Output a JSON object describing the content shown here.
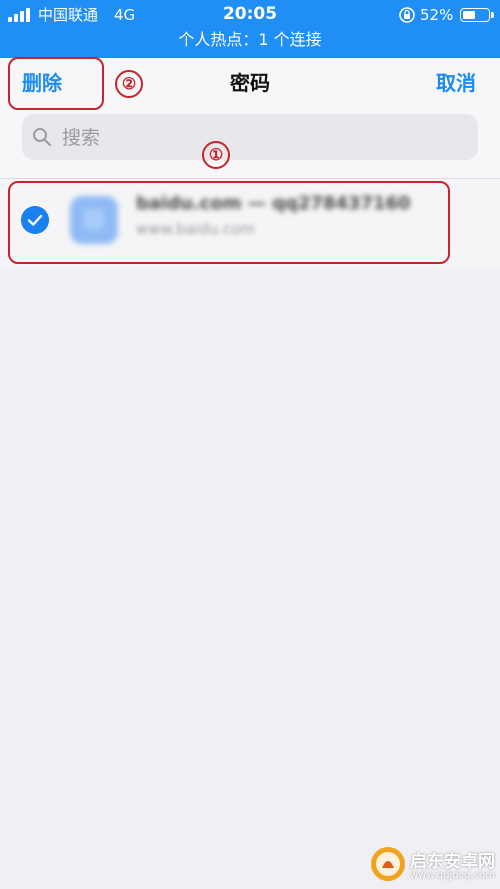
{
  "status_bar": {
    "carrier": "中国联通",
    "network": "4G",
    "time": "20:05",
    "battery": "52%",
    "battery_level": 0.52,
    "hotspot": "个人热点：1 个连接",
    "color": "#1f8ff5"
  },
  "nav": {
    "delete_label": "删除",
    "title": "密码",
    "cancel_label": "取消",
    "accent": "#1a8cf0"
  },
  "search": {
    "placeholder": "搜索"
  },
  "list": {
    "items": [
      {
        "title": "baidu.com — qq278437160",
        "subtitle": "www.baidu.com",
        "selected": true
      }
    ]
  },
  "annotations": {
    "num1": "①",
    "num2": "②",
    "color": "#c8242c"
  },
  "watermark": {
    "name": "启东安卓网",
    "url": "www.qdjdcq.com"
  }
}
